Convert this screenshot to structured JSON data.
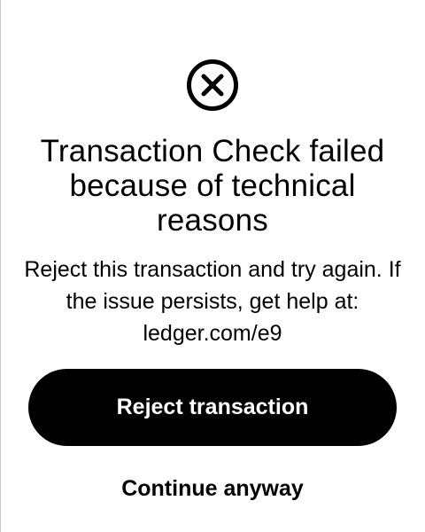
{
  "screen": {
    "icon": "close-circle-icon",
    "title": "Transaction Check failed because of technical reasons",
    "message": "Reject this transaction and try again. If the issue persists, get help at: ledger.com/e9"
  },
  "actions": {
    "primary_label": "Reject transaction",
    "secondary_label": "Continue anyway"
  },
  "colors": {
    "background": "#ffffff",
    "primary_button": "#000000",
    "primary_button_text": "#ffffff",
    "text": "#000000"
  }
}
